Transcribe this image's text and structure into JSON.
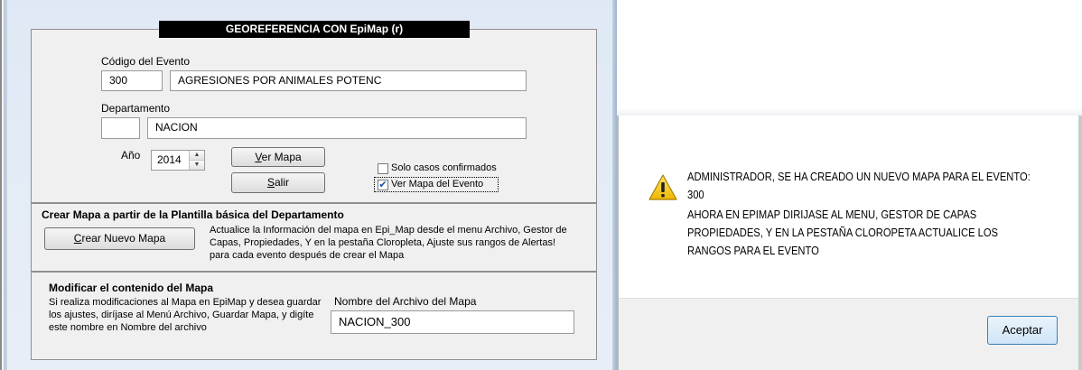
{
  "left_window": {
    "title": "GEOREFERENCIA CON EpiMap (r)",
    "codigo_label": "Código del Evento",
    "codigo_value": "300",
    "evento_name": "AGRESIONES POR ANIMALES POTENC",
    "departamento_label": "Departamento",
    "departamento_code": "",
    "departamento_name": "NACION",
    "anio_label": "Año",
    "anio_value": "2014",
    "ver_mapa_mnemonic": "V",
    "ver_mapa_rest": "er Mapa",
    "salir_mnemonic": "S",
    "salir_rest": "alir",
    "solo_casos_label": "Solo casos confirmados",
    "solo_casos_checked": false,
    "ver_mapa_evento_label": "Ver Mapa del Evento",
    "ver_mapa_evento_checked": true,
    "crear_section_title": "Crear Mapa a partir de la Plantilla básica del Departamento",
    "crear_btn_mnemonic": "C",
    "crear_btn_rest": "rear Nuevo  Mapa",
    "crear_text": "Actualice la Información del mapa en Epi_Map desde el menu Archivo, Gestor de Capas, Propiedades, Y en la pestaña Cloropleta, Ajuste sus rangos de Alertas! para cada evento después de crear el Mapa",
    "modificar_title": "Modificar el contenido del Mapa",
    "modificar_text": "Si realiza modificaciones al Mapa en EpiMap y desea guardar los ajustes, diríjase al Menú Archivo, Guardar Mapa, y digíte este nombre en Nombre del archivo",
    "nombre_archivo_label": "Nombre del Archivo del Mapa",
    "nombre_archivo_value": "NACION_300"
  },
  "dialog": {
    "icon": "warning-icon",
    "lines": [
      "ADMINISTRADOR, SE HA CREADO UN NUEVO MAPA PARA EL EVENTO:",
      "300",
      "AHORA EN EPIMAP DIRIJASE AL MENU, GESTOR DE CAPAS",
      "PROPIEDADES, Y EN LA PESTAÑA CLOROPETA ACTUALICE LOS",
      "RANGOS PARA EL EVENTO"
    ],
    "ok_label": "Aceptar"
  },
  "colors": {
    "title_bg": "#000000",
    "title_fg": "#ffffff",
    "panel_bg": "#f0f0f0",
    "ok_border": "#3c7fb1",
    "warning_yellow": "#f5c400"
  }
}
